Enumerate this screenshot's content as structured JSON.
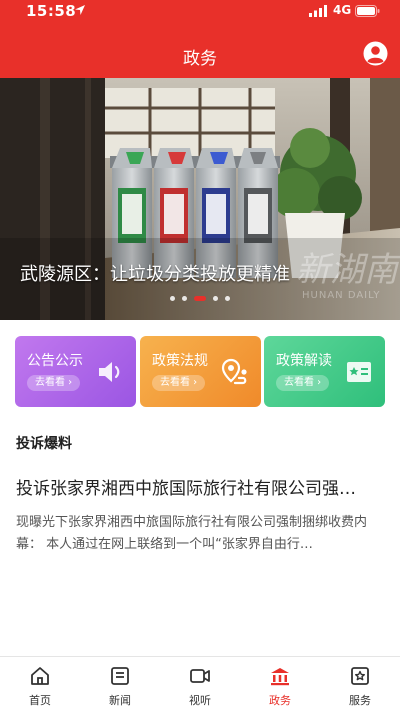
{
  "status_bar": {
    "time": "15:58",
    "network": "4G"
  },
  "header": {
    "title": "政务"
  },
  "banner": {
    "caption": "武陵源区：让垃圾分类投放更精准",
    "watermark_cn": "新湖南",
    "watermark_en": "HUNAN DAILY",
    "slide_count": 5,
    "active_slide": 2
  },
  "cards": [
    {
      "title": "公告公示",
      "link": "去看看 ›",
      "icon": "speaker-icon",
      "color": "#b166ea"
    },
    {
      "title": "政策法规",
      "link": "去看看 ›",
      "icon": "map-pin-icon",
      "color": "#f39a34"
    },
    {
      "title": "政策解读",
      "link": "去看看 ›",
      "icon": "certificate-icon",
      "color": "#43cc88"
    }
  ],
  "complaint_section": {
    "title": "投诉爆料",
    "article": {
      "title": "投诉张家界湘西中旅国际旅行社有限公司强…",
      "summary": "现曝光下张家界湘西中旅国际旅行社有限公司强制捆绑收费内幕：   本人通过在网上联络到一个叫“张家界自由行…"
    }
  },
  "tabbar": {
    "items": [
      {
        "label": "首页",
        "icon": "home-icon"
      },
      {
        "label": "新闻",
        "icon": "news-icon"
      },
      {
        "label": "视听",
        "icon": "video-icon"
      },
      {
        "label": "政务",
        "icon": "government-icon"
      },
      {
        "label": "服务",
        "icon": "service-icon"
      }
    ],
    "active": 3
  },
  "colors": {
    "brand": "#e8302a",
    "text": "#222222",
    "muted": "#555555"
  }
}
